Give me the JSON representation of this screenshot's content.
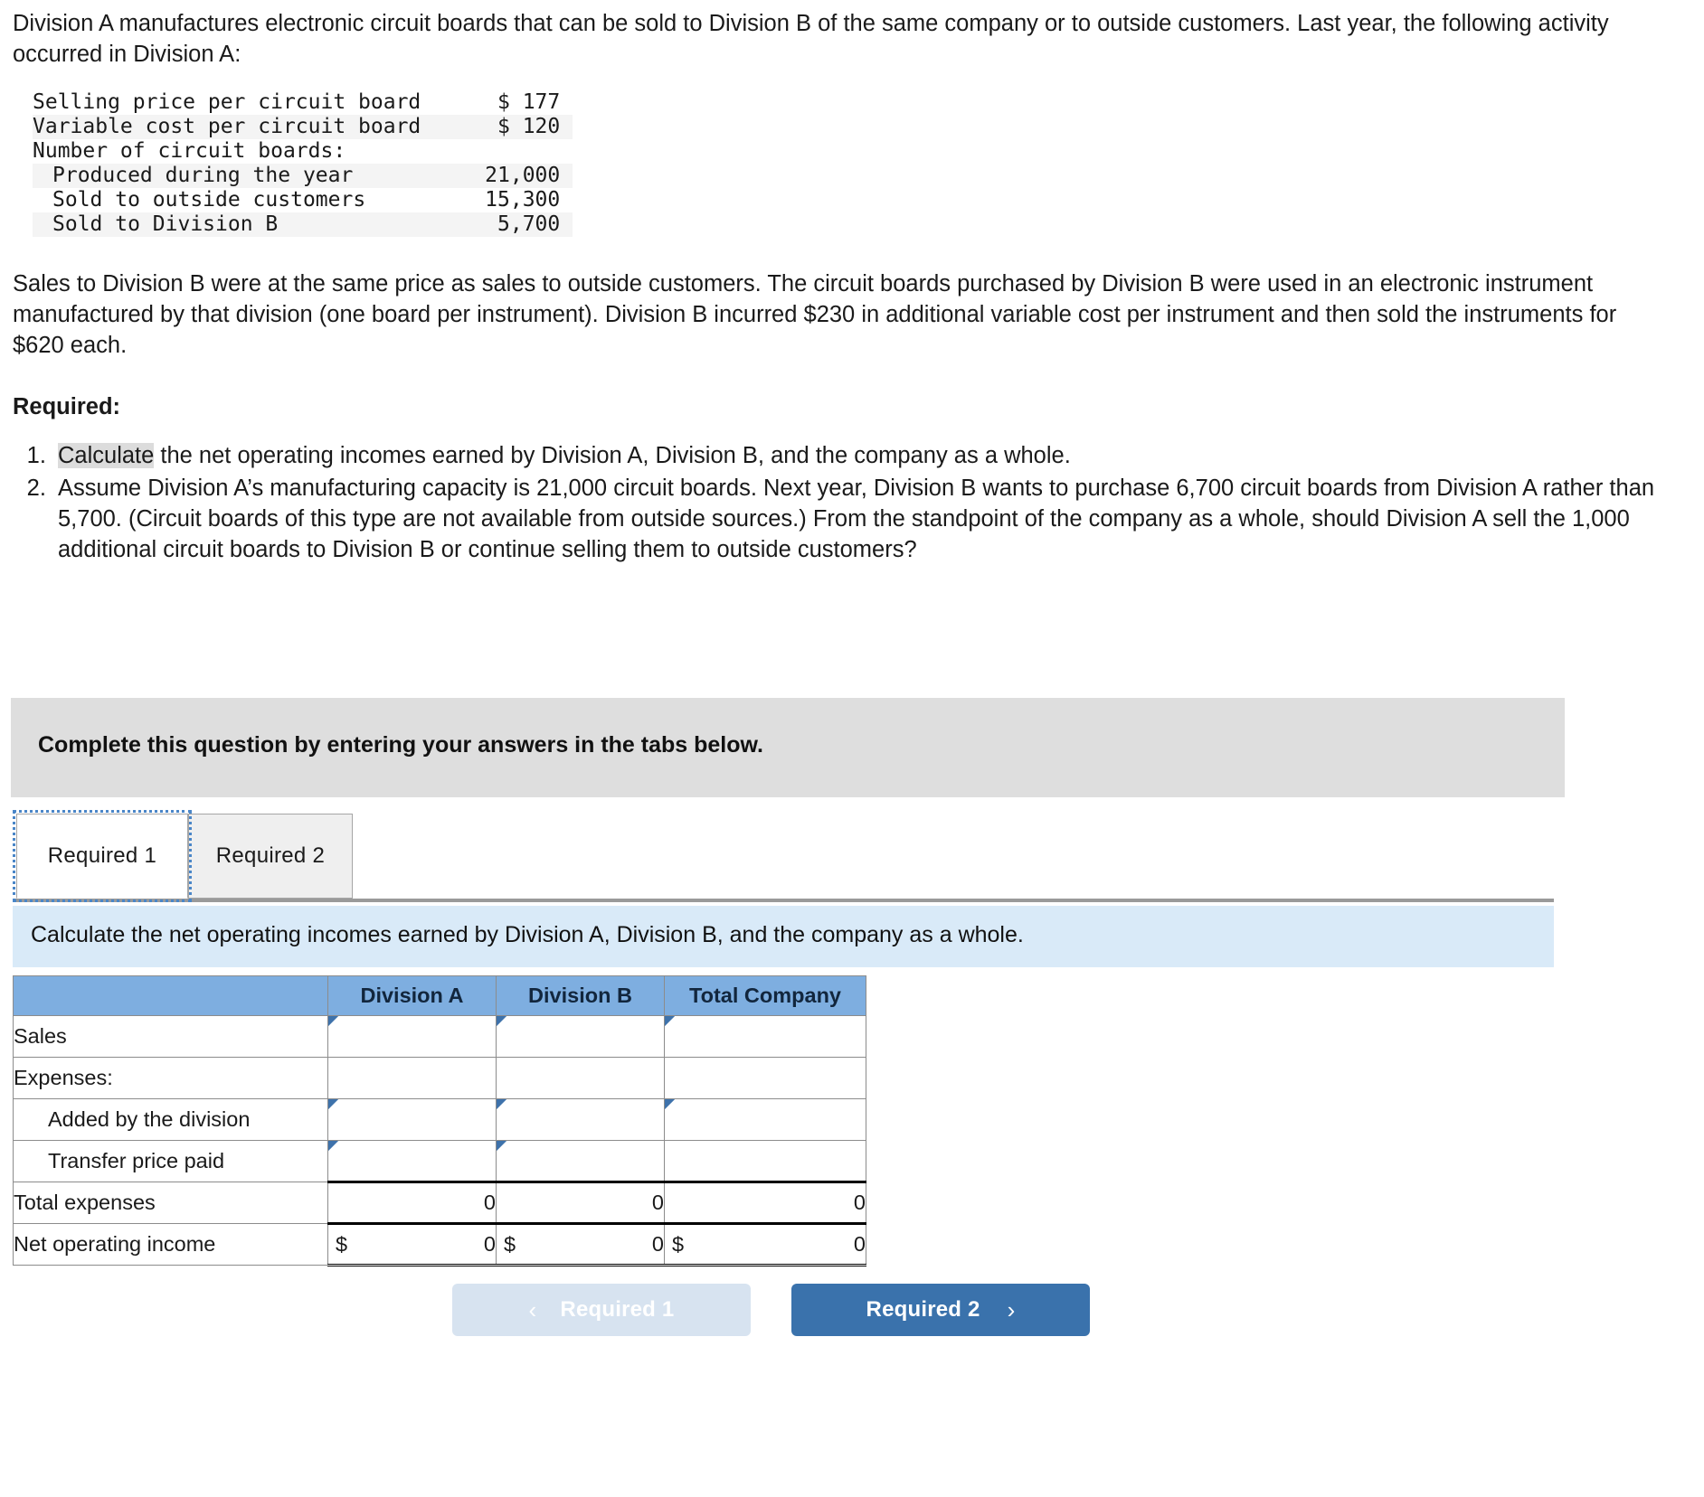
{
  "intro": {
    "paragraph1": "Division A manufactures electronic circuit boards that can be sold to Division B of the same company or to outside customers. Last year, the following activity occurred in Division A:"
  },
  "fact_table": {
    "rows": [
      {
        "label": "Selling price per circuit board",
        "value": "$ 177",
        "indent": 0,
        "shaded": false
      },
      {
        "label": "Variable cost per circuit board",
        "value": "$ 120",
        "indent": 0,
        "shaded": true
      },
      {
        "label": "Number of circuit boards:",
        "value": "",
        "indent": 0,
        "shaded": false
      },
      {
        "label": "Produced during the year",
        "value": "21,000",
        "indent": 1,
        "shaded": true
      },
      {
        "label": "Sold to outside customers",
        "value": "15,300",
        "indent": 1,
        "shaded": false
      },
      {
        "label": "Sold to Division B",
        "value": "5,700",
        "indent": 1,
        "shaded": true
      }
    ]
  },
  "body": {
    "paragraph2": "Sales to Division B were at the same price as sales to outside customers. The circuit boards purchased by Division B were used in an electronic instrument manufactured by that division (one board per instrument). Division B incurred $230 in additional variable cost per instrument and then sold the instruments for $620 each.",
    "required_label": "Required:",
    "items": [
      {
        "highlight": "Calculate",
        "rest": " the net operating incomes earned by Division A, Division B, and the company as a whole."
      },
      {
        "highlight": "",
        "rest": "Assume Division A’s manufacturing capacity is 21,000 circuit boards. Next year, Division B wants to purchase 6,700 circuit boards from Division A rather than 5,700. (Circuit boards of this type are not available from outside sources.) From the standpoint of the company as a whole, should Division A sell the 1,000 additional circuit boards to Division B or continue selling them to outside customers?"
      }
    ]
  },
  "instruction_bar": {
    "text": "Complete this question by entering your answers in the tabs below."
  },
  "tabs": {
    "items": [
      {
        "label": "Required 1",
        "active": true
      },
      {
        "label": "Required 2",
        "active": false
      }
    ]
  },
  "sub_instruction": {
    "text": "Calculate the net operating incomes earned by Division A, Division B, and the company as a whole."
  },
  "answer_table": {
    "headers": [
      "",
      "Division A",
      "Division B",
      "Total Company"
    ],
    "rows": [
      {
        "label": "Sales",
        "indent": false,
        "cells": [
          {
            "type": "input",
            "value": ""
          },
          {
            "type": "input",
            "value": ""
          },
          {
            "type": "input",
            "value": ""
          }
        ]
      },
      {
        "label": "Expenses:",
        "indent": false,
        "cells": [
          {
            "type": "blank",
            "value": ""
          },
          {
            "type": "blank",
            "value": ""
          },
          {
            "type": "blank",
            "value": ""
          }
        ]
      },
      {
        "label": "Added by the division",
        "indent": true,
        "cells": [
          {
            "type": "input",
            "value": ""
          },
          {
            "type": "input",
            "value": ""
          },
          {
            "type": "input",
            "value": ""
          }
        ]
      },
      {
        "label": "Transfer price paid",
        "indent": true,
        "cells": [
          {
            "type": "input",
            "value": ""
          },
          {
            "type": "input",
            "value": ""
          },
          {
            "type": "blank",
            "value": ""
          }
        ]
      },
      {
        "label": "Total expenses",
        "indent": false,
        "rowstyle": "totals",
        "cells": [
          {
            "type": "num",
            "value": "0"
          },
          {
            "type": "num",
            "value": "0"
          },
          {
            "type": "num",
            "value": "0"
          }
        ]
      },
      {
        "label": "Net operating income",
        "indent": false,
        "rowstyle": "final",
        "cells": [
          {
            "type": "num",
            "value": "0",
            "prefix": "$"
          },
          {
            "type": "num",
            "value": "0",
            "prefix": "$"
          },
          {
            "type": "num",
            "value": "0",
            "prefix": "$"
          }
        ]
      }
    ]
  },
  "nav": {
    "prev_label": "Required 1",
    "prev_chevron": "‹",
    "next_label": "Required 2",
    "next_chevron": "›"
  },
  "colors": {
    "header_blue": "#7eaee0",
    "input_border": "#3e72ab",
    "sub_instruction_bg": "#d9eaf8",
    "instruction_bg": "#dedede",
    "primary_button": "#3a72ac",
    "disabled_button": "#d7e3f0",
    "highlight": "#dcdcdc"
  }
}
